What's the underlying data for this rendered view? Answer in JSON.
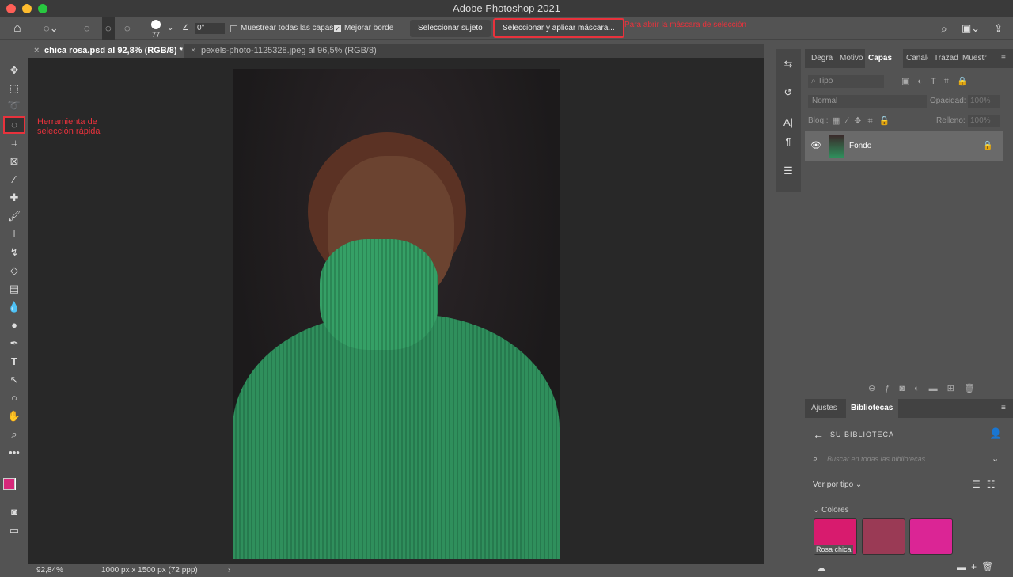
{
  "app": {
    "title": "Adobe Photoshop 2021"
  },
  "options": {
    "brush_size": "77",
    "angle": "0°",
    "sample_all": "Muestrear todas las capas",
    "enhance_edge": "Mejorar borde",
    "select_subject": "Seleccionar sujeto",
    "select_mask": "Seleccionar y aplicar máscara...",
    "annotation": "Para abrir la máscara de selección"
  },
  "tabs": [
    {
      "label": "chica rosa.psd al 92,8% (RGB/8) *",
      "active": true
    },
    {
      "label": "pexels-photo-1125328.jpeg al 96,5% (RGB/8)",
      "active": false
    }
  ],
  "toolbar": {
    "annotation_line1": "Herramienta de",
    "annotation_line2": "selección rápida",
    "foreground_color": "#d6287a"
  },
  "status": {
    "zoom": "92,84%",
    "doc_info": "1000 px x 1500 px (72 ppp)"
  },
  "layers_panel": {
    "tabs": [
      "Degra",
      "Motivo",
      "Capas",
      "Canales",
      "Trazados",
      "Muestr"
    ],
    "active_tab": "Capas",
    "filter": "Tipo",
    "blend_mode": "Normal",
    "opacity_label": "Opacidad:",
    "opacity": "100%",
    "lock_label": "Bloq.:",
    "fill_label": "Relleno:",
    "fill": "100%",
    "layers": [
      {
        "name": "Fondo",
        "visible": true,
        "locked": true
      }
    ]
  },
  "libraries_panel": {
    "tabs": [
      "Ajustes",
      "Bibliotecas"
    ],
    "active_tab": "Bibliotecas",
    "title": "SU BIBLIOTECA",
    "search_placeholder": "Buscar en todas las bibliotecas",
    "view_by": "Ver por tipo",
    "section": "Colores",
    "colors": [
      {
        "name": "Rosa chica",
        "hex": "#d81b6e"
      },
      {
        "name": "",
        "hex": "#9a3a55"
      },
      {
        "name": "",
        "hex": "#db2595"
      }
    ]
  }
}
